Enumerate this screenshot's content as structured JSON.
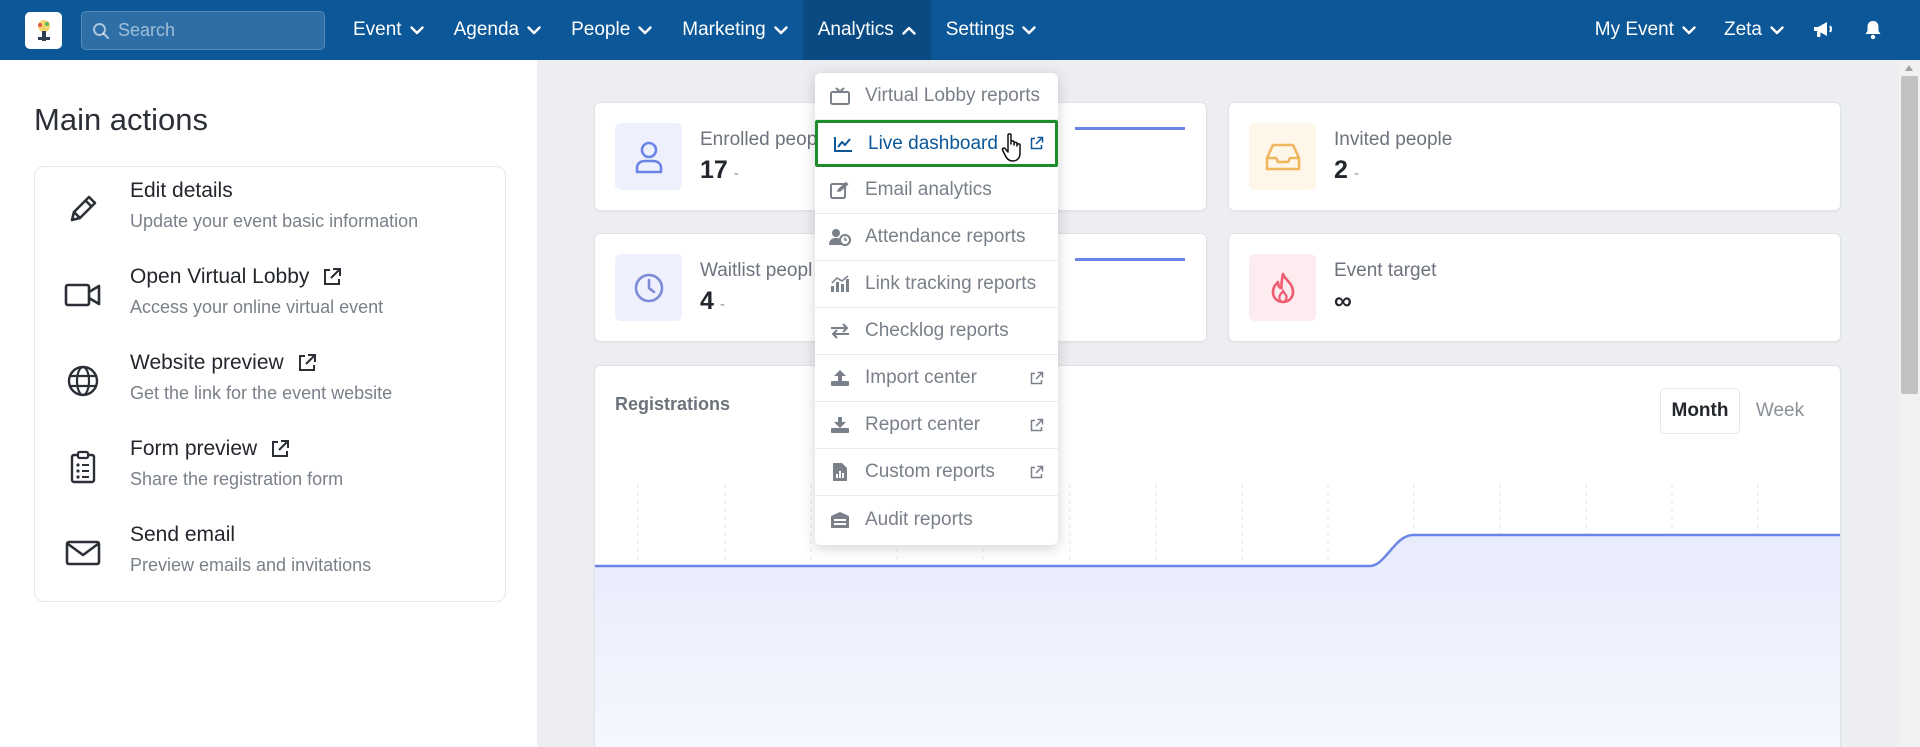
{
  "topbar": {
    "search_placeholder": "Search",
    "nav": [
      {
        "label": "Event"
      },
      {
        "label": "Agenda"
      },
      {
        "label": "People"
      },
      {
        "label": "Marketing"
      },
      {
        "label": "Analytics"
      },
      {
        "label": "Settings"
      }
    ],
    "active_nav": "Analytics",
    "right": [
      {
        "label": "My Event"
      },
      {
        "label": "Zeta"
      }
    ]
  },
  "left": {
    "heading": "Main actions",
    "actions": [
      {
        "title": "Edit details",
        "subtitle": "Update your event basic information",
        "icon": "pencil-icon",
        "external": false
      },
      {
        "title": "Open Virtual Lobby",
        "subtitle": "Access your online virtual event",
        "icon": "video-camera-icon",
        "external": true
      },
      {
        "title": "Website preview",
        "subtitle": "Get the link for the event website",
        "icon": "globe-icon",
        "external": true
      },
      {
        "title": "Form preview",
        "subtitle": "Share the registration form",
        "icon": "clipboard-icon",
        "external": true
      },
      {
        "title": "Send email",
        "subtitle": "Preview emails and invitations",
        "icon": "envelope-icon",
        "external": false
      }
    ]
  },
  "stats": {
    "enrolled": {
      "label": "Enrolled peop",
      "value": "17",
      "delta": "-"
    },
    "invited": {
      "label": "Invited people",
      "value": "2",
      "delta": "-"
    },
    "waitlist": {
      "label": "Waitlist peopl",
      "value": "4",
      "delta": "-"
    },
    "target": {
      "label": "Event target",
      "value": "∞"
    }
  },
  "registrations": {
    "title": "Registrations",
    "tabs": [
      "Month",
      "Week"
    ],
    "active_tab": "Month"
  },
  "analytics_menu": [
    {
      "label": "Virtual Lobby reports",
      "icon": "tv-icon",
      "external": false
    },
    {
      "label": "Live dashboard",
      "icon": "line-chart-icon",
      "external": true,
      "highlighted": true
    },
    {
      "label": "Email analytics",
      "icon": "edit-icon",
      "external": false
    },
    {
      "label": "Attendance reports",
      "icon": "user-clock-icon",
      "external": false
    },
    {
      "label": "Link tracking reports",
      "icon": "bar-chart-icon",
      "external": false
    },
    {
      "label": "Checklog reports",
      "icon": "exchange-icon",
      "external": false
    },
    {
      "label": "Import center",
      "icon": "upload-icon",
      "external": true
    },
    {
      "label": "Report center",
      "icon": "download-icon",
      "external": true
    },
    {
      "label": "Custom reports",
      "icon": "file-chart-icon",
      "external": true
    },
    {
      "label": "Audit reports",
      "icon": "archive-icon",
      "external": false
    }
  ],
  "colors": {
    "nav_bg": "#0b5798",
    "accent": "#6b84e8",
    "highlight_border": "#1f8c2b"
  }
}
